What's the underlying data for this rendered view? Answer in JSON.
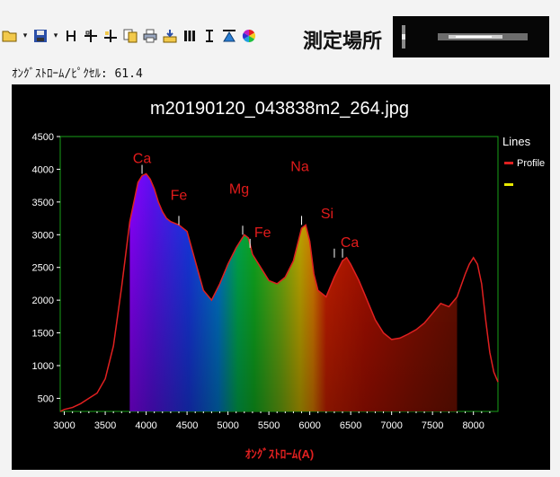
{
  "toolbar": {
    "icons": [
      "open-folder-icon",
      "dropdown-arrow-icon",
      "save-disk-icon",
      "dropdown-arrow-icon",
      "horizontal-flip-icon",
      "crosshair-icon",
      "calibrate-icon",
      "copy-icon",
      "print-icon",
      "export-icon",
      "bars-icon",
      "vertical-marker-icon",
      "triangle-marker-icon",
      "color-wheel-icon"
    ],
    "location_label": "測定場所"
  },
  "status": {
    "text": "ｵﾝｸﾞｽﾄﾛｰﾑ/ﾋﾟｸｾﾙ: 61.4"
  },
  "colors": {
    "curve": "#e02020",
    "grid_border": "#18a018",
    "label": "#e21b1b",
    "legend_second": "#e8e800",
    "background": "#000000"
  },
  "chart_data": {
    "type": "area",
    "title": "m20190120_043838m2_264.jpg",
    "xlabel": "ｵﾝｸﾞｽﾄﾛｰﾑ(A)",
    "ylabel": "",
    "xlim": [
      2950,
      8300
    ],
    "ylim": [
      300,
      4500
    ],
    "xticks": [
      3000,
      3500,
      4000,
      4500,
      5000,
      5500,
      6000,
      6500,
      7000,
      7500,
      8000
    ],
    "yticks": [
      500,
      1000,
      1500,
      2000,
      2500,
      3000,
      3500,
      4000,
      4500
    ],
    "grid": false,
    "legend": {
      "title": "Lines",
      "position": "right",
      "entries": [
        {
          "name": "Profile",
          "color": "#e02020"
        },
        {
          "name": "",
          "color": "#e8e800"
        }
      ]
    },
    "spectrum_fill_range": [
      3800,
      7800
    ],
    "series": [
      {
        "name": "Profile",
        "points": [
          [
            2950,
            300
          ],
          [
            3000,
            330
          ],
          [
            3100,
            360
          ],
          [
            3200,
            420
          ],
          [
            3300,
            500
          ],
          [
            3400,
            580
          ],
          [
            3500,
            800
          ],
          [
            3600,
            1300
          ],
          [
            3700,
            2200
          ],
          [
            3800,
            3200
          ],
          [
            3900,
            3800
          ],
          [
            3950,
            3900
          ],
          [
            4000,
            3930
          ],
          [
            4050,
            3850
          ],
          [
            4100,
            3700
          ],
          [
            4150,
            3500
          ],
          [
            4200,
            3350
          ],
          [
            4250,
            3250
          ],
          [
            4300,
            3200
          ],
          [
            4400,
            3150
          ],
          [
            4500,
            3050
          ],
          [
            4600,
            2600
          ],
          [
            4700,
            2150
          ],
          [
            4800,
            2000
          ],
          [
            4900,
            2250
          ],
          [
            5000,
            2550
          ],
          [
            5100,
            2800
          ],
          [
            5200,
            3000
          ],
          [
            5250,
            2950
          ],
          [
            5300,
            2700
          ],
          [
            5400,
            2500
          ],
          [
            5500,
            2300
          ],
          [
            5600,
            2250
          ],
          [
            5700,
            2350
          ],
          [
            5800,
            2600
          ],
          [
            5900,
            3100
          ],
          [
            5950,
            3150
          ],
          [
            6000,
            2900
          ],
          [
            6050,
            2400
          ],
          [
            6100,
            2150
          ],
          [
            6200,
            2050
          ],
          [
            6300,
            2350
          ],
          [
            6400,
            2600
          ],
          [
            6450,
            2650
          ],
          [
            6500,
            2550
          ],
          [
            6600,
            2300
          ],
          [
            6700,
            2000
          ],
          [
            6800,
            1700
          ],
          [
            6900,
            1500
          ],
          [
            7000,
            1400
          ],
          [
            7100,
            1420
          ],
          [
            7200,
            1480
          ],
          [
            7300,
            1550
          ],
          [
            7400,
            1650
          ],
          [
            7500,
            1800
          ],
          [
            7600,
            1950
          ],
          [
            7700,
            1900
          ],
          [
            7800,
            2050
          ],
          [
            7900,
            2400
          ],
          [
            7950,
            2550
          ],
          [
            8000,
            2650
          ],
          [
            8050,
            2550
          ],
          [
            8100,
            2250
          ],
          [
            8150,
            1700
          ],
          [
            8200,
            1200
          ],
          [
            8250,
            900
          ],
          [
            8300,
            750
          ]
        ]
      }
    ],
    "annotations": [
      {
        "text": "Ca",
        "x": 3950,
        "y": 3930
      },
      {
        "text": "Fe",
        "x": 4400,
        "y": 3150
      },
      {
        "text": "Mg",
        "x": 5180,
        "y": 3000
      },
      {
        "text": "Fe",
        "x": 5270,
        "y": 2800
      },
      {
        "text": "Na",
        "x": 5900,
        "y": 3150
      },
      {
        "text": "Si",
        "x": 6300,
        "y": 2650
      },
      {
        "text": "Ca",
        "x": 6400,
        "y": 2650
      }
    ]
  }
}
